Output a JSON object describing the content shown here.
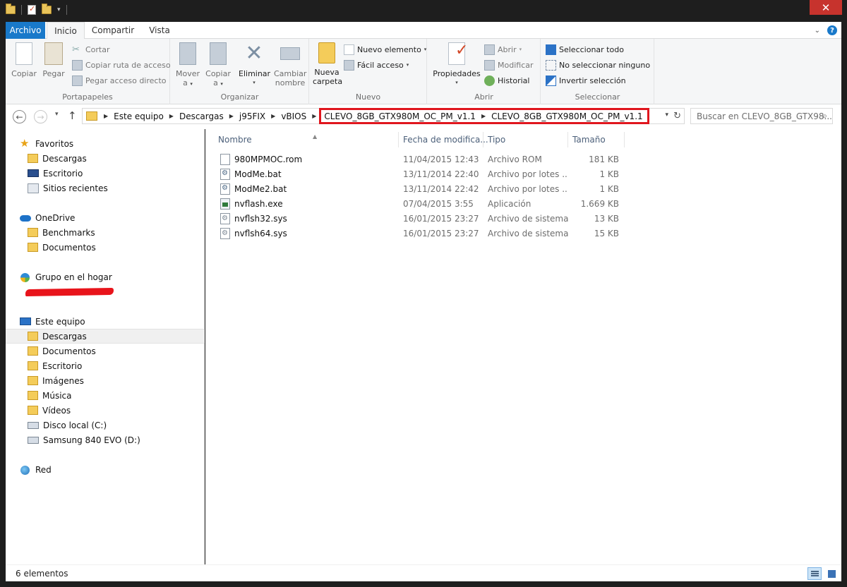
{
  "window": {
    "close_icon": "✕"
  },
  "ribbon_tabs": [
    {
      "label": "Archivo"
    },
    {
      "label": "Inicio"
    },
    {
      "label": "Compartir"
    },
    {
      "label": "Vista"
    }
  ],
  "ribbon": {
    "portapapeles": {
      "label": "Portapapeles",
      "copy": "Copiar",
      "paste": "Pegar",
      "cut": "Cortar",
      "copy_path": "Copiar ruta de acceso",
      "paste_shortcut": "Pegar acceso directo"
    },
    "organizar": {
      "label": "Organizar",
      "move_to_1": "Mover",
      "move_to_2": "a",
      "copy_to_1": "Copiar",
      "copy_to_2": "a",
      "delete": "Eliminar",
      "rename_1": "Cambiar",
      "rename_2": "nombre"
    },
    "nuevo": {
      "label": "Nuevo",
      "new_folder_1": "Nueva",
      "new_folder_2": "carpeta",
      "new_item": "Nuevo elemento",
      "easy_access": "Fácil acceso"
    },
    "abrir": {
      "label": "Abrir",
      "properties": "Propiedades",
      "open": "Abrir",
      "edit": "Modificar",
      "history": "Historial"
    },
    "seleccionar": {
      "label": "Seleccionar",
      "select_all": "Seleccionar todo",
      "select_none": "No seleccionar ninguno",
      "invert": "Invertir selección"
    }
  },
  "address": {
    "crumbs": [
      "Este equipo",
      "Descargas",
      "j95FIX",
      "vBIOS"
    ],
    "highlighted_crumbs": [
      "CLEVO_8GB_GTX980M_OC_PM_v1.1",
      "CLEVO_8GB_GTX980M_OC_PM_v1.1"
    ],
    "search_placeholder": "Buscar en CLEVO_8GB_GTX98..."
  },
  "nav": {
    "favorites": "Favoritos",
    "fav_items": [
      "Descargas",
      "Escritorio",
      "Sitios recientes"
    ],
    "onedrive": "OneDrive",
    "onedrive_items": [
      "Benchmarks",
      "Documentos"
    ],
    "homegroup": "Grupo en el hogar",
    "this_pc": "Este equipo",
    "pc_items": [
      "Descargas",
      "Documentos",
      "Escritorio",
      "Imágenes",
      "Música",
      "Vídeos",
      "Disco local (C:)",
      "Samsung 840 EVO (D:)"
    ],
    "network": "Red"
  },
  "columns": {
    "name": "Nombre",
    "date": "Fecha de modifica...",
    "type": "Tipo",
    "size": "Tamaño"
  },
  "files": [
    {
      "name": "980MPMOC.rom",
      "date": "11/04/2015 12:43",
      "type": "Archivo ROM",
      "size": "181 KB",
      "icon": "rom-file-icon"
    },
    {
      "name": "ModMe.bat",
      "date": "13/11/2014 22:40",
      "type": "Archivo por lotes ...",
      "size": "1 KB",
      "icon": "batch-file-icon"
    },
    {
      "name": "ModMe2.bat",
      "date": "13/11/2014 22:42",
      "type": "Archivo por lotes ...",
      "size": "1 KB",
      "icon": "batch-file-icon"
    },
    {
      "name": "nvflash.exe",
      "date": "07/04/2015 3:55",
      "type": "Aplicación",
      "size": "1.669 KB",
      "icon": "exe-file-icon"
    },
    {
      "name": "nvflsh32.sys",
      "date": "16/01/2015 23:27",
      "type": "Archivo de sistema",
      "size": "13 KB",
      "icon": "sys-file-icon"
    },
    {
      "name": "nvflsh64.sys",
      "date": "16/01/2015 23:27",
      "type": "Archivo de sistema",
      "size": "15 KB",
      "icon": "sys-file-icon"
    }
  ],
  "status": {
    "count": "6 elementos"
  },
  "colors": {
    "accent": "#1979ca",
    "highlight_box": "#e0161e",
    "close_button": "#c7332d"
  }
}
